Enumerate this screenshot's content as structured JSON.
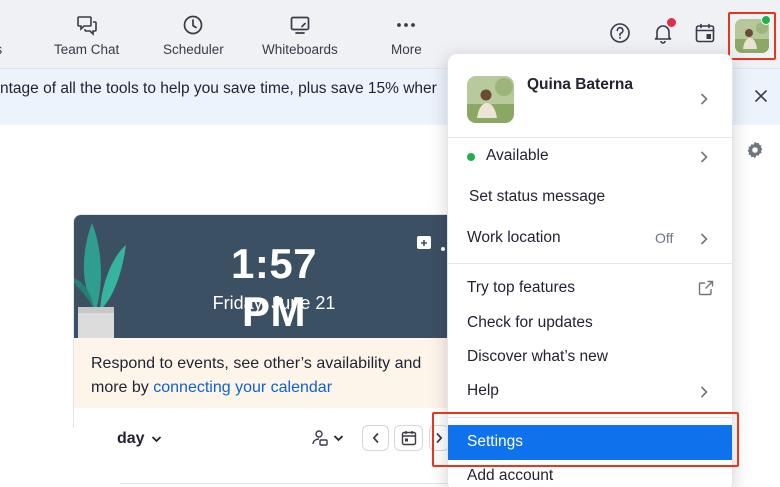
{
  "nav": {
    "items": [
      {
        "label": "gs",
        "icon": "meetings-icon"
      },
      {
        "label": "Team Chat",
        "icon": "chat-icon"
      },
      {
        "label": "Scheduler",
        "icon": "clock-icon"
      },
      {
        "label": "Whiteboards",
        "icon": "whiteboard-icon"
      },
      {
        "label": "More",
        "icon": "more-dots-icon"
      }
    ]
  },
  "promo": {
    "text": "ntage of all the tools to help you save time, plus save 15% wher"
  },
  "calendar_card": {
    "time": "1:57 PM",
    "date": "Friday, June 21",
    "note_text": "Respond to events, see other’s availability and",
    "note_text2": "more by ",
    "note_link": "connecting your calendar",
    "today_label": "day"
  },
  "menu": {
    "user_name": "Quina Baterna",
    "status": "Available",
    "set_status": "Set status message",
    "work_location": "Work location",
    "work_location_value": "Off",
    "try_features": "Try top features",
    "check_updates": "Check for updates",
    "discover": "Discover what’s new",
    "help": "Help",
    "settings": "Settings",
    "add_account": "Add account"
  },
  "colors": {
    "accent": "#0e72ed",
    "highlight": "#e8361c",
    "online": "#1fb24a",
    "hero": "#3c5064"
  }
}
